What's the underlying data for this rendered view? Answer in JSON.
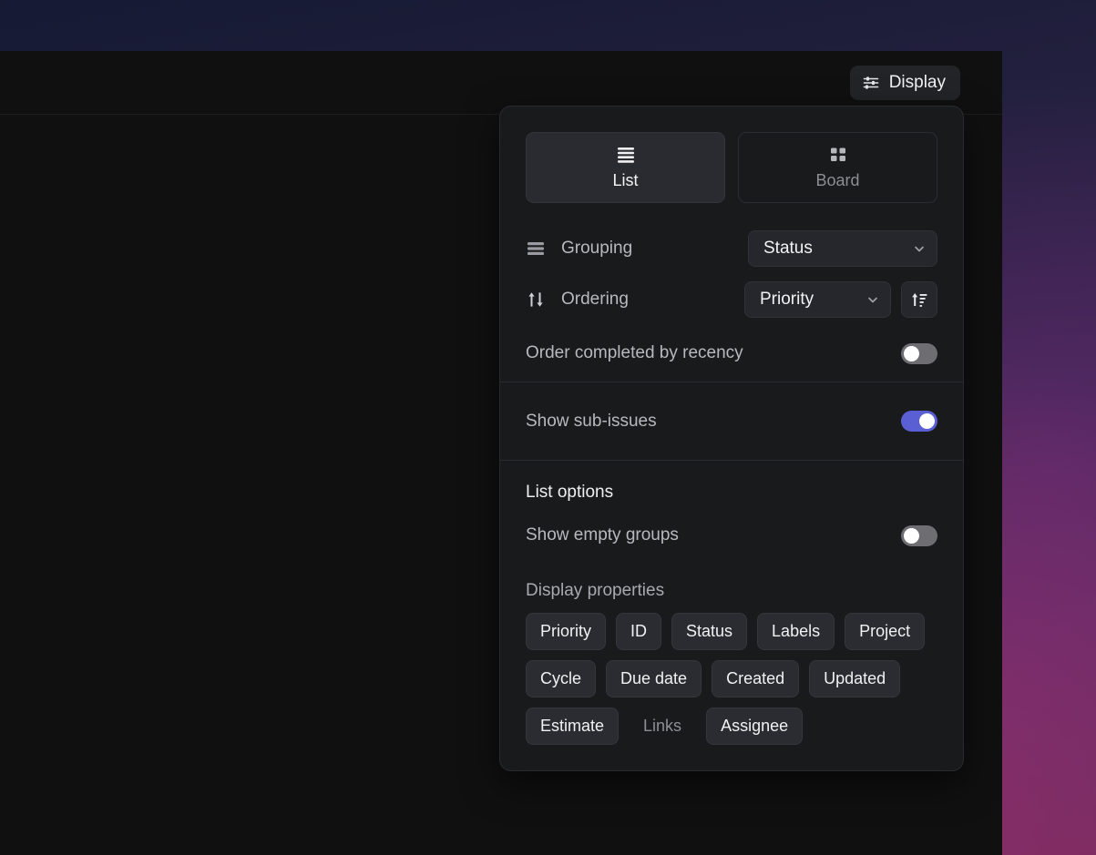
{
  "header": {
    "display_button": {
      "label": "Display",
      "icon": "sliders-icon"
    }
  },
  "panel": {
    "view_switch": {
      "options": [
        {
          "label": "List",
          "icon": "list-icon",
          "selected": true
        },
        {
          "label": "Board",
          "icon": "board-icon",
          "selected": false
        }
      ]
    },
    "grouping": {
      "label": "Grouping",
      "icon": "stacked-bars-icon",
      "value": "Status",
      "chevron": "chevron-down-icon"
    },
    "ordering": {
      "label": "Ordering",
      "icon": "arrows-up-down-icon",
      "value": "Priority",
      "chevron": "chevron-down-icon",
      "sort_direction_icon": "sort-ascending-icon"
    },
    "order_completed": {
      "label": "Order completed by recency",
      "enabled": false
    },
    "show_sub_issues": {
      "label": "Show sub-issues",
      "enabled": true
    },
    "list_options": {
      "title": "List options",
      "show_empty_groups": {
        "label": "Show empty groups",
        "enabled": false
      },
      "display_properties": {
        "title": "Display properties",
        "chips": [
          {
            "label": "Priority",
            "active": true
          },
          {
            "label": "ID",
            "active": true
          },
          {
            "label": "Status",
            "active": true
          },
          {
            "label": "Labels",
            "active": true
          },
          {
            "label": "Project",
            "active": true
          },
          {
            "label": "Cycle",
            "active": true
          },
          {
            "label": "Due date",
            "active": true
          },
          {
            "label": "Created",
            "active": true
          },
          {
            "label": "Updated",
            "active": true
          },
          {
            "label": "Estimate",
            "active": true
          },
          {
            "label": "Links",
            "active": false
          },
          {
            "label": "Assignee",
            "active": true
          }
        ]
      }
    }
  },
  "colors": {
    "accent": "#5a5fd4",
    "panel_bg": "#191a1c",
    "window_bg": "#101011",
    "chip_active_bg": "#2b2c32"
  }
}
